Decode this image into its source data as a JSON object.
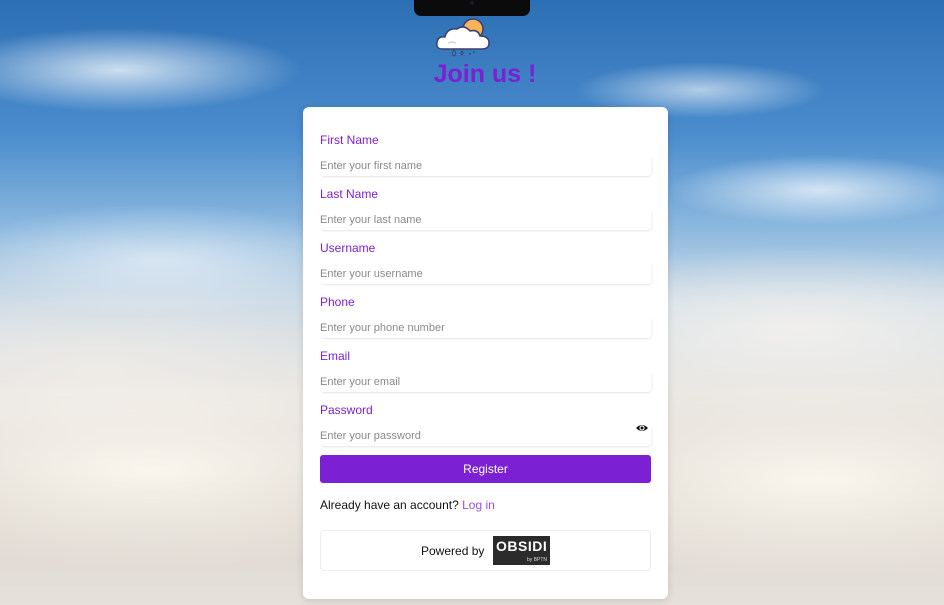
{
  "header": {
    "title": "Join us !"
  },
  "form": {
    "fields": [
      {
        "label": "First Name",
        "placeholder": "Enter your first name",
        "type": "text"
      },
      {
        "label": "Last Name",
        "placeholder": "Enter your last name",
        "type": "text"
      },
      {
        "label": "Username",
        "placeholder": "Enter your username",
        "type": "text"
      },
      {
        "label": "Phone",
        "placeholder": "Enter your phone number",
        "type": "tel"
      },
      {
        "label": "Email",
        "placeholder": "Enter your email",
        "type": "email"
      },
      {
        "label": "Password",
        "placeholder": "Enter your password",
        "type": "password"
      }
    ],
    "register_label": "Register",
    "account_prompt": "Already have an account?",
    "login_label": "Log in"
  },
  "footer": {
    "powered_by": "Powered by",
    "brand_name": "OBSIDI",
    "brand_sub": "by BPTN"
  },
  "icons": {
    "logo": "cloud-sun-rain-icon",
    "password_toggle": "eye-icon"
  },
  "colors": {
    "accent": "#7b20d3",
    "link": "#9a4fe0",
    "sun": "#f6b35a",
    "cloud_outline": "#3a3f6b"
  }
}
